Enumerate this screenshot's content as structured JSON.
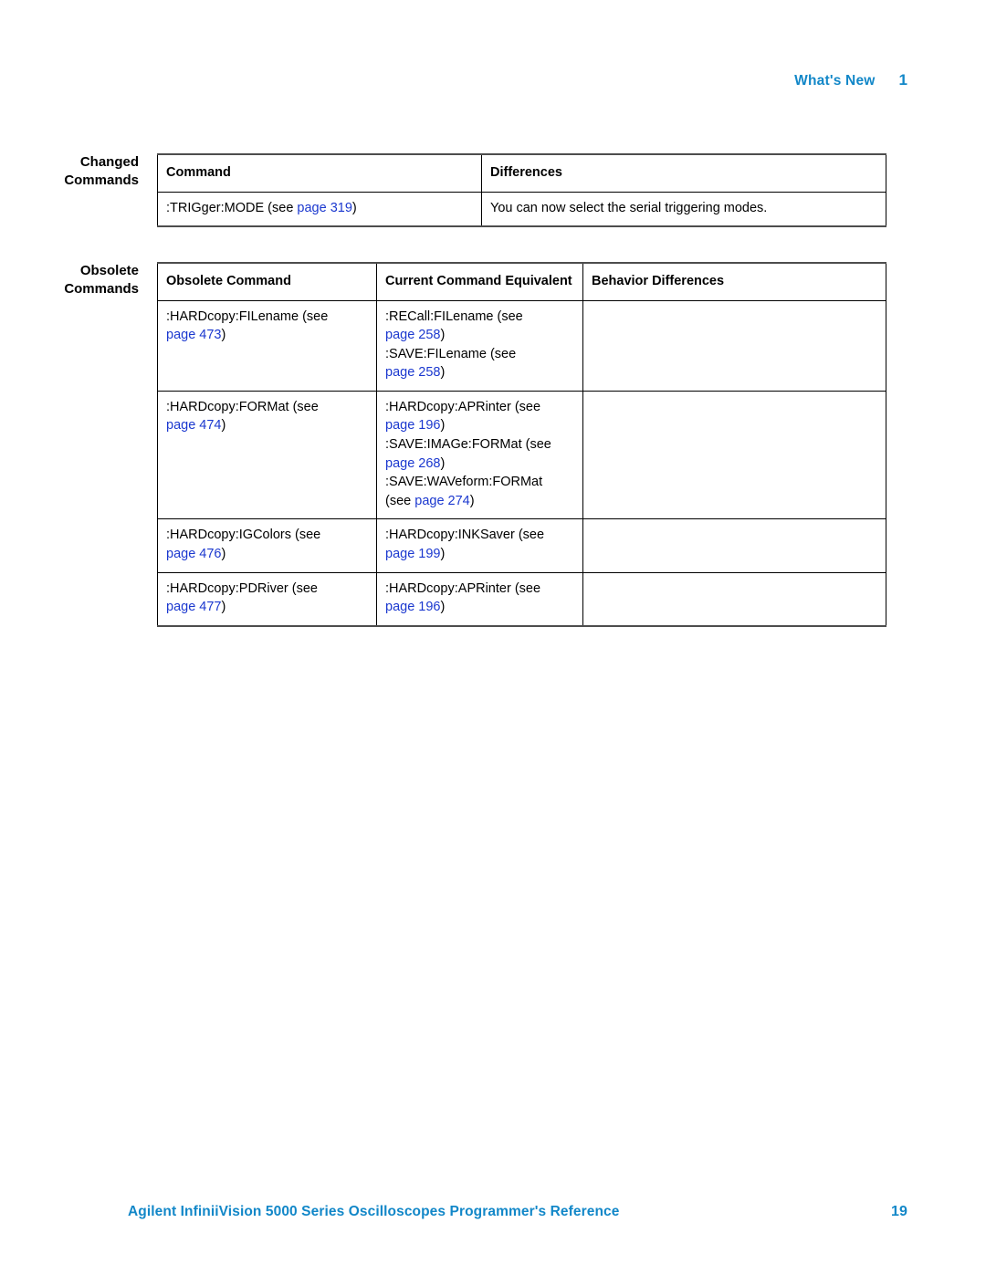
{
  "header": {
    "title": "What's New",
    "chapter": "1"
  },
  "sections": [
    {
      "label_lines": [
        "Changed",
        "Commands"
      ],
      "table": {
        "headers": [
          "Command",
          "Differences"
        ],
        "rows": [
          {
            "cells": [
              [
                [
                  {
                    "t": "text",
                    "v": ":TRIGger:MODE (see "
                  },
                  {
                    "t": "link",
                    "v": "page 319"
                  },
                  {
                    "t": "text",
                    "v": ")"
                  }
                ]
              ],
              [
                [
                  {
                    "t": "text",
                    "v": "You can now select the serial triggering modes."
                  }
                ]
              ]
            ]
          }
        ]
      }
    },
    {
      "label_lines": [
        "Obsolete",
        "Commands"
      ],
      "table": {
        "headers": [
          "Obsolete Command",
          "Current Command Equivalent",
          "Behavior Differences"
        ],
        "rows": [
          {
            "cells": [
              [
                [
                  {
                    "t": "text",
                    "v": ":HARDcopy:FILename (see"
                  }
                ],
                [
                  {
                    "t": "link",
                    "v": "page 473"
                  },
                  {
                    "t": "text",
                    "v": ")"
                  }
                ]
              ],
              [
                [
                  {
                    "t": "text",
                    "v": ":RECall:FILename (see"
                  }
                ],
                [
                  {
                    "t": "link",
                    "v": "page 258"
                  },
                  {
                    "t": "text",
                    "v": ")"
                  }
                ],
                [
                  {
                    "t": "text",
                    "v": ":SAVE:FILename (see"
                  }
                ],
                [
                  {
                    "t": "link",
                    "v": "page 258"
                  },
                  {
                    "t": "text",
                    "v": ")"
                  }
                ]
              ],
              []
            ]
          },
          {
            "cells": [
              [
                [
                  {
                    "t": "text",
                    "v": ":HARDcopy:FORMat (see"
                  }
                ],
                [
                  {
                    "t": "link",
                    "v": "page 474"
                  },
                  {
                    "t": "text",
                    "v": ")"
                  }
                ]
              ],
              [
                [
                  {
                    "t": "text",
                    "v": ":HARDcopy:APRinter (see"
                  }
                ],
                [
                  {
                    "t": "link",
                    "v": "page 196"
                  },
                  {
                    "t": "text",
                    "v": ")"
                  }
                ],
                [
                  {
                    "t": "text",
                    "v": ":SAVE:IMAGe:FORMat (see"
                  }
                ],
                [
                  {
                    "t": "link",
                    "v": "page 268"
                  },
                  {
                    "t": "text",
                    "v": ")"
                  }
                ],
                [
                  {
                    "t": "text",
                    "v": ":SAVE:WAVeform:FORMat"
                  }
                ],
                [
                  {
                    "t": "text",
                    "v": "(see "
                  },
                  {
                    "t": "link",
                    "v": "page 274"
                  },
                  {
                    "t": "text",
                    "v": ")"
                  }
                ]
              ],
              []
            ]
          },
          {
            "cells": [
              [
                [
                  {
                    "t": "text",
                    "v": ":HARDcopy:IGColors (see"
                  }
                ],
                [
                  {
                    "t": "link",
                    "v": "page 476"
                  },
                  {
                    "t": "text",
                    "v": ")"
                  }
                ]
              ],
              [
                [
                  {
                    "t": "text",
                    "v": ":HARDcopy:INKSaver (see"
                  }
                ],
                [
                  {
                    "t": "link",
                    "v": "page 199"
                  },
                  {
                    "t": "text",
                    "v": ")"
                  }
                ]
              ],
              []
            ]
          },
          {
            "cells": [
              [
                [
                  {
                    "t": "text",
                    "v": ":HARDcopy:PDRiver (see"
                  }
                ],
                [
                  {
                    "t": "link",
                    "v": "page 477"
                  },
                  {
                    "t": "text",
                    "v": ")"
                  }
                ]
              ],
              [
                [
                  {
                    "t": "text",
                    "v": ":HARDcopy:APRinter (see"
                  }
                ],
                [
                  {
                    "t": "link",
                    "v": "page 196"
                  },
                  {
                    "t": "text",
                    "v": ")"
                  }
                ]
              ],
              []
            ]
          }
        ]
      }
    }
  ],
  "footer": {
    "book_title": "Agilent InfiniiVision 5000 Series Oscilloscopes Programmer's Reference",
    "page_number": "19"
  },
  "colors": {
    "header_blue": "#1287c8",
    "link_blue": "#1b38cf",
    "rule": "#4d4d4d",
    "text": "#000000"
  }
}
